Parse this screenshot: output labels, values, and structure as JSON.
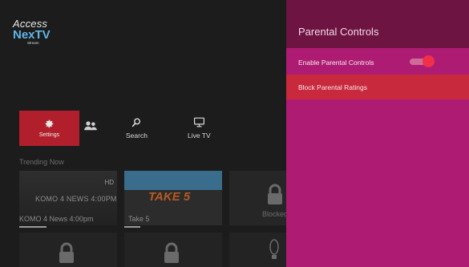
{
  "brand": {
    "line1": "Access",
    "line2": "NexTV",
    "line3": "Stream"
  },
  "nav": {
    "settings_label": "Settings",
    "search_label": "Search",
    "livetv_label": "Live TV"
  },
  "section": {
    "title": "Trending Now"
  },
  "tiles": [
    {
      "label": "KOMO 4 News 4:00pm",
      "overlay": "KOMO 4 NEWS 4:00PM",
      "badge": "HD",
      "progress": 0.28
    },
    {
      "label": "Take 5",
      "overlay": "TAKE 5",
      "progress": 0.16
    },
    {
      "label": "Blocked"
    }
  ],
  "panel": {
    "title": "Parental Controls",
    "items": [
      {
        "label": "Enable Parental Controls",
        "toggle_on": true
      },
      {
        "label": "Block Parental Ratings"
      }
    ]
  },
  "colors": {
    "panel": "#ad1c72",
    "header": "#6e1442",
    "selected": "#c9293c",
    "settings_tile": "#b21f2c",
    "toggle_knob": "#f0304a"
  }
}
